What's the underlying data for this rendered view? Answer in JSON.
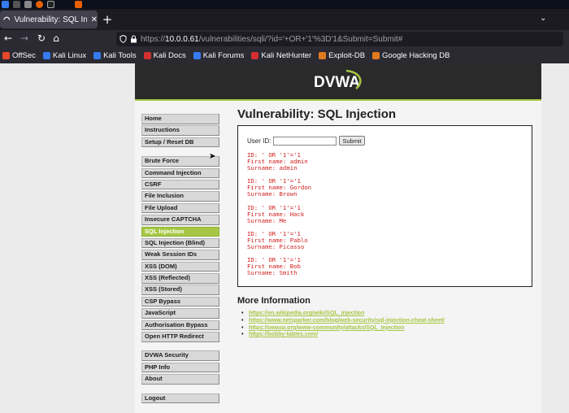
{
  "browser": {
    "tab_title": "Vulnerability: SQL Injection",
    "url_prefix": "https://",
    "url_host": "10.0.0.61",
    "url_path": "/vulnerabilities/sqli/?id='+OR+'1'%3D'1&Submit=Submit#"
  },
  "bookmarks": [
    {
      "label": "OffSec",
      "color": "#e4472b"
    },
    {
      "label": "Kali Linux",
      "color": "#367bf0"
    },
    {
      "label": "Kali Tools",
      "color": "#367bf0"
    },
    {
      "label": "Kali Docs",
      "color": "#d32f2f"
    },
    {
      "label": "Kali Forums",
      "color": "#367bf0"
    },
    {
      "label": "Kali NetHunter",
      "color": "#d32f2f"
    },
    {
      "label": "Exploit-DB",
      "color": "#e07a1f"
    },
    {
      "label": "Google Hacking DB",
      "color": "#e07a1f"
    }
  ],
  "app": {
    "logo_text": "DVWA",
    "accent": "#a7c744"
  },
  "menu": {
    "group1": [
      "Home",
      "Instructions",
      "Setup / Reset DB"
    ],
    "group2": [
      "Brute Force",
      "Command Injection",
      "CSRF",
      "File Inclusion",
      "File Upload",
      "Insecure CAPTCHA",
      "SQL Injection",
      "SQL Injection (Blind)",
      "Weak Session IDs",
      "XSS (DOM)",
      "XSS (Reflected)",
      "XSS (Stored)",
      "CSP Bypass",
      "JavaScript",
      "Authorisation Bypass",
      "Open HTTP Redirect"
    ],
    "group3": [
      "DVWA Security",
      "PHP Info",
      "About"
    ],
    "group4": [
      "Logout"
    ],
    "active": "SQL Injection"
  },
  "main": {
    "title": "Vulnerability: SQL Injection",
    "user_id_label": "User ID:",
    "user_id_value": "",
    "submit_label": "Submit",
    "results": [
      "ID: ' OR '1'='1\nFirst name: admin\nSurname: admin",
      "ID: ' OR '1'='1\nFirst name: Gordon\nSurname: Brown",
      "ID: ' OR '1'='1\nFirst name: Hack\nSurname: Me",
      "ID: ' OR '1'='1\nFirst name: Pablo\nSurname: Picasso",
      "ID: ' OR '1'='1\nFirst name: Bob\nSurname: Smith"
    ],
    "more_info_title": "More Information",
    "links": [
      "https://en.wikipedia.org/wiki/SQL_injection",
      "https://www.netsparker.com/blog/web-security/sql-injection-cheat-sheet/",
      "https://owasp.org/www-community/attacks/SQL_Injection",
      "https://bobby-tables.com/"
    ]
  }
}
